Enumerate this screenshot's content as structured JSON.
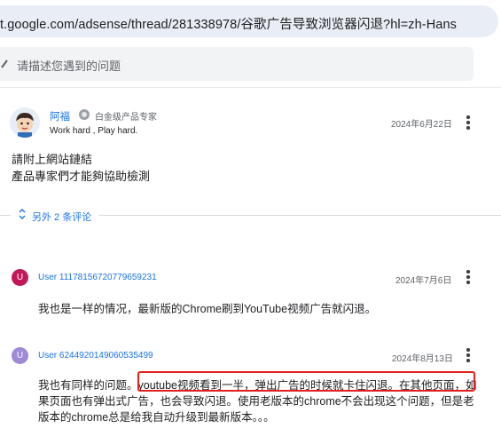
{
  "browser": {
    "url": "t.google.com/adsense/thread/281338978/谷歌广告导致浏览器闪退?hl=zh-Hans"
  },
  "search": {
    "icon": "search-icon",
    "placeholder": "请描述您遇到的问题"
  },
  "post": {
    "author": "阿福",
    "badge": "白金级产品专家",
    "motto": "Work hard , Play hard.",
    "date": "2024年6月22日",
    "body_lines": [
      "請附上網站鏈結",
      "產品專家們才能夠協助檢測"
    ]
  },
  "more_comments": {
    "label": "另外 2 条评论"
  },
  "comments": [
    {
      "avatar_letter": "U",
      "avatar_color": "#c2185b",
      "user": "User 11178156720779659231",
      "date": "2024年7月6日",
      "text_lines": [
        "我也是一样的情况，最新版的Chrome刷到YouTube视频广告就闪退。"
      ]
    },
    {
      "avatar_letter": "U",
      "avatar_color": "#9e8ad8",
      "user": "User 6244920149060535499",
      "date": "2024年8月13日",
      "text_lines": [
        "我也有同样的问题。youtube视频看到一半，弹出广告的时候就卡住闪退。在其他页面，如",
        "果页面也有弹出式广告，也会导致闪退。使用老版本的chrome不会出现这个问题，但是老",
        "版本的chrome总是给我自动升级到最新版本。。。"
      ]
    }
  ],
  "colors": {
    "link_blue": "#1a73e8",
    "highlight_red": "#e02020"
  }
}
